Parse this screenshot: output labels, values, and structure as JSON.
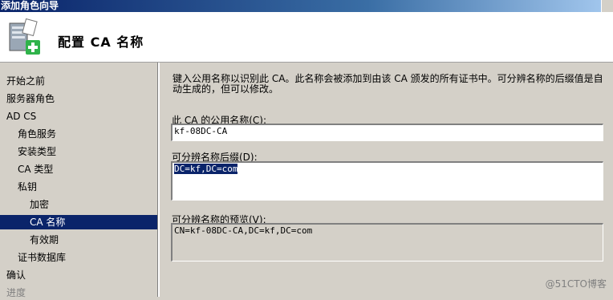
{
  "window": {
    "title": "添加角色向导"
  },
  "header": {
    "title": "配置 CA 名称",
    "icon": "server-role-add-icon"
  },
  "nav": {
    "items": [
      {
        "label": "开始之前",
        "indent": 0,
        "state": "normal"
      },
      {
        "label": "服务器角色",
        "indent": 0,
        "state": "normal"
      },
      {
        "label": "AD CS",
        "indent": 0,
        "state": "normal"
      },
      {
        "label": "角色服务",
        "indent": 1,
        "state": "normal"
      },
      {
        "label": "安装类型",
        "indent": 1,
        "state": "normal"
      },
      {
        "label": "CA 类型",
        "indent": 1,
        "state": "normal"
      },
      {
        "label": "私钥",
        "indent": 1,
        "state": "normal"
      },
      {
        "label": "加密",
        "indent": 2,
        "state": "normal"
      },
      {
        "label": "CA 名称",
        "indent": 2,
        "state": "selected"
      },
      {
        "label": "有效期",
        "indent": 2,
        "state": "normal"
      },
      {
        "label": "证书数据库",
        "indent": 1,
        "state": "normal"
      },
      {
        "label": "确认",
        "indent": 0,
        "state": "normal"
      },
      {
        "label": "进度",
        "indent": 0,
        "state": "dim"
      }
    ]
  },
  "main": {
    "description": "键入公用名称以识别此 CA。此名称会被添加到由该 CA 颁发的所有证书中。可分辨名称的后缀值是自动生成的，但可以修改。",
    "common_name": {
      "label": "此 CA 的公用名称(C):",
      "value": "kf-08DC-CA"
    },
    "dn_suffix": {
      "label": "可分辨名称后缀(D):",
      "value": "DC=kf,DC=com"
    },
    "dn_preview": {
      "label": "可分辨名称的预览(V):",
      "value": "CN=kf-08DC-CA,DC=kf,DC=com"
    }
  },
  "watermark": "@51CTO博客",
  "colors": {
    "selection": "#0a246a",
    "face": "#d4d0c8"
  }
}
